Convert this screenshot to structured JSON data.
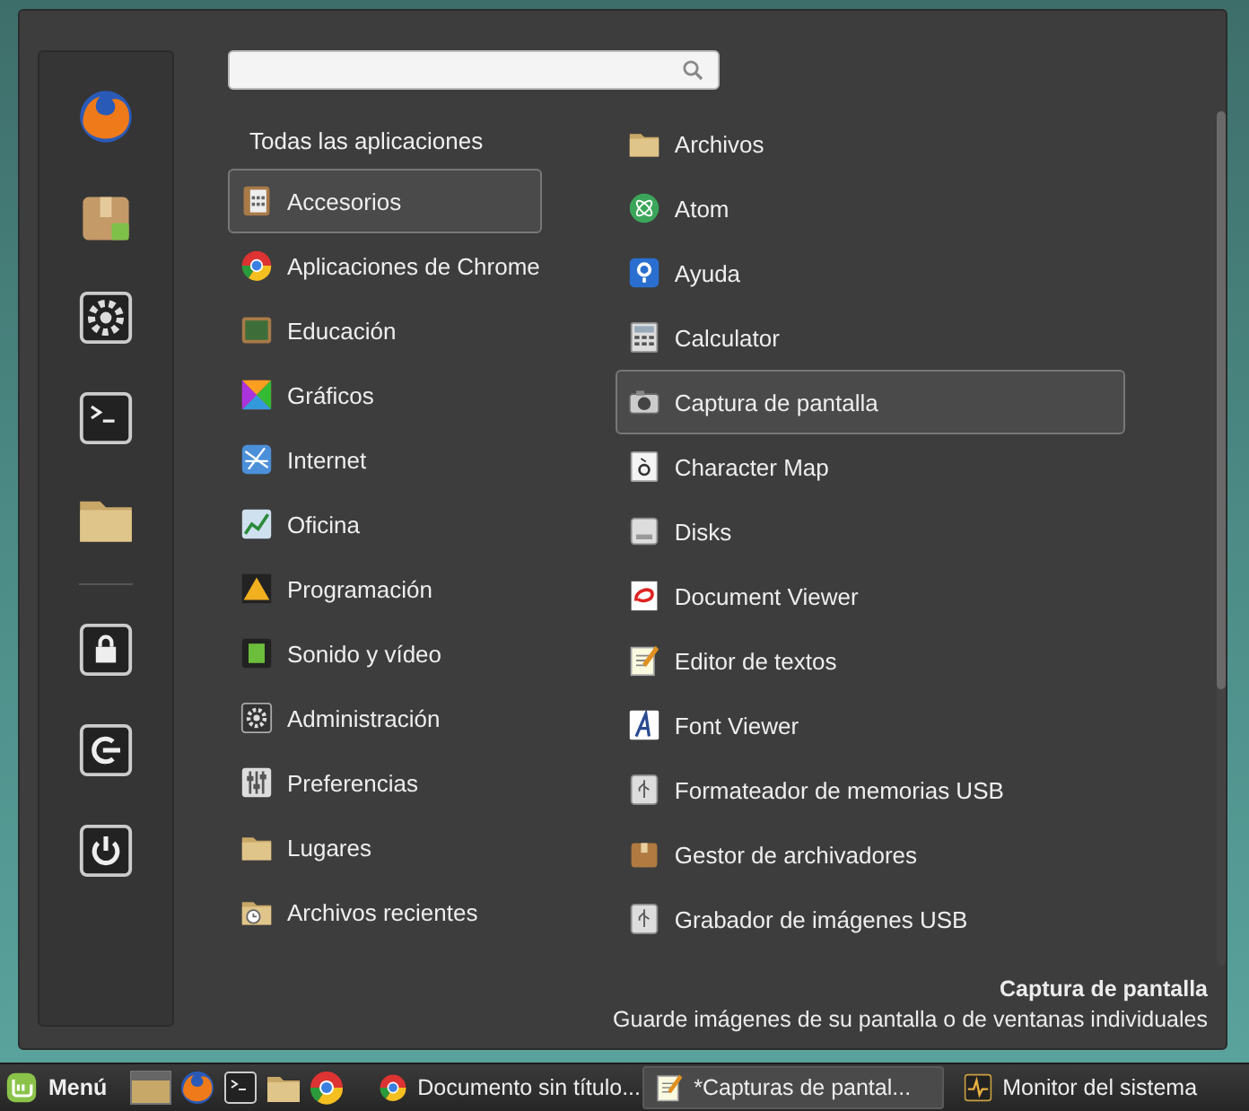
{
  "categories_header": "Todas las aplicaciones",
  "categories": [
    {
      "label": "Accesorios",
      "selected": true
    },
    {
      "label": "Aplicaciones de Chrome",
      "selected": false
    },
    {
      "label": "Educación",
      "selected": false
    },
    {
      "label": "Gráficos",
      "selected": false
    },
    {
      "label": "Internet",
      "selected": false
    },
    {
      "label": "Oficina",
      "selected": false
    },
    {
      "label": "Programación",
      "selected": false
    },
    {
      "label": "Sonido y vídeo",
      "selected": false
    },
    {
      "label": "Administración",
      "selected": false
    },
    {
      "label": "Preferencias",
      "selected": false
    },
    {
      "label": "Lugares",
      "selected": false
    },
    {
      "label": "Archivos recientes",
      "selected": false
    }
  ],
  "apps": [
    {
      "label": "Archivos",
      "selected": false
    },
    {
      "label": "Atom",
      "selected": false
    },
    {
      "label": "Ayuda",
      "selected": false
    },
    {
      "label": "Calculator",
      "selected": false
    },
    {
      "label": "Captura de pantalla",
      "selected": true
    },
    {
      "label": "Character Map",
      "selected": false
    },
    {
      "label": "Disks",
      "selected": false
    },
    {
      "label": "Document Viewer",
      "selected": false
    },
    {
      "label": "Editor de textos",
      "selected": false
    },
    {
      "label": "Font Viewer",
      "selected": false
    },
    {
      "label": "Formateador de memorias USB",
      "selected": false
    },
    {
      "label": "Gestor de archivadores",
      "selected": false
    },
    {
      "label": "Grabador de imágenes USB",
      "selected": false
    }
  ],
  "description": {
    "title": "Captura de pantalla",
    "text": "Guarde imágenes de su pantalla o de ventanas individuales"
  },
  "taskbar": {
    "menu_label": "Menú",
    "windows": [
      {
        "label": "Documento sin título...",
        "selected": false
      },
      {
        "label": "*Capturas de pantal...",
        "selected": true
      },
      {
        "label": "Monitor del sistema",
        "selected": false
      }
    ]
  }
}
